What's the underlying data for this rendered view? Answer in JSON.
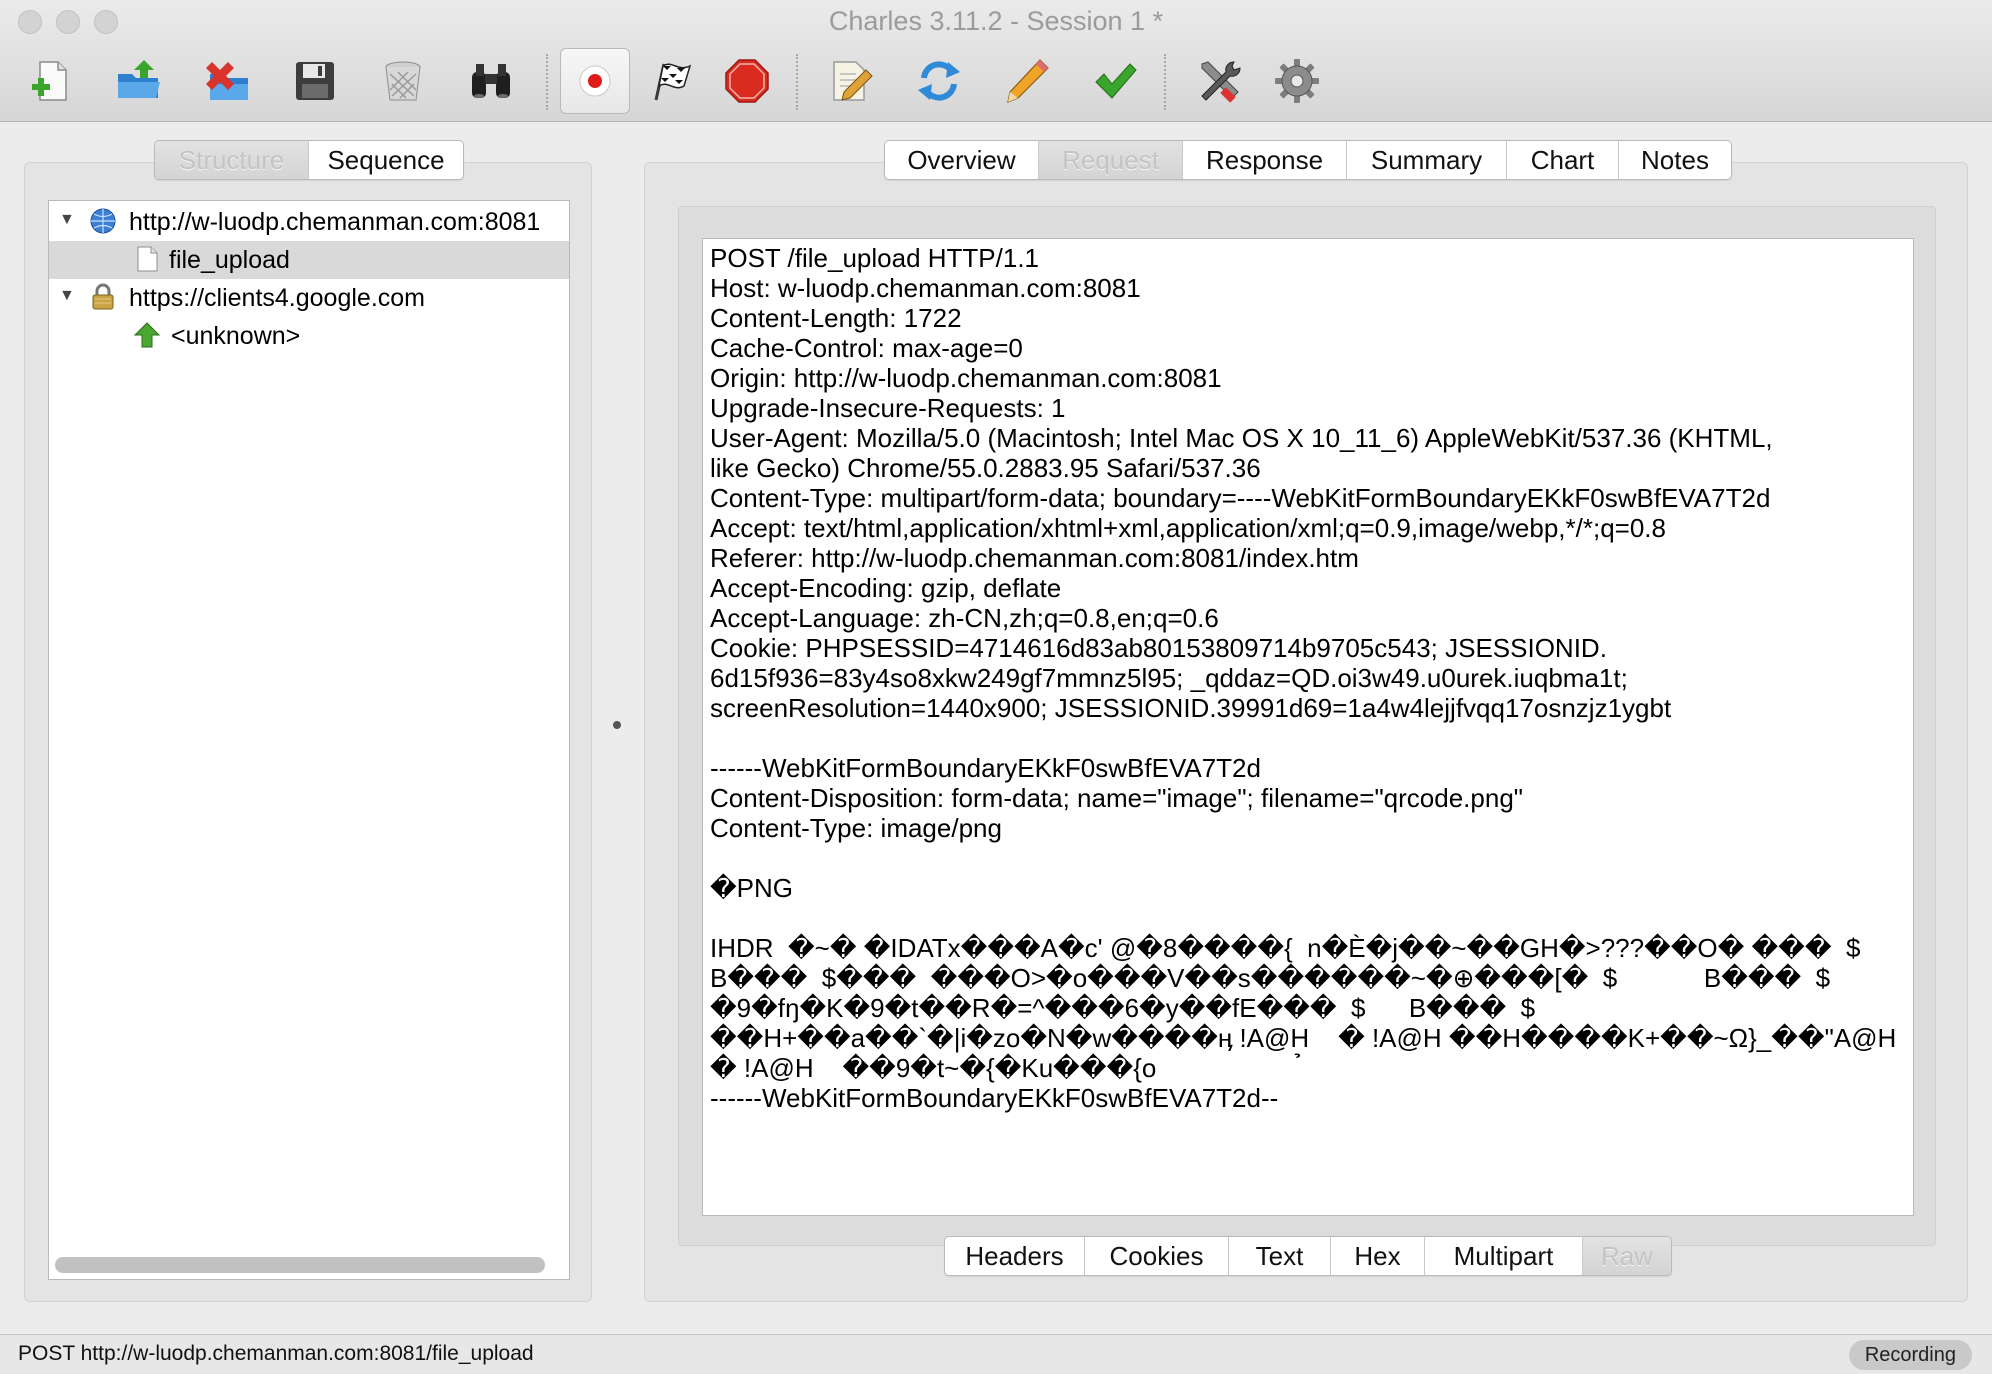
{
  "window": {
    "title": "Charles 3.11.2 - Session 1 *"
  },
  "toolbar": {
    "buttons": [
      {
        "name": "new-session",
        "icon": "new-session-icon"
      },
      {
        "name": "open-session",
        "icon": "open-folder-icon"
      },
      {
        "name": "close-session",
        "icon": "close-session-icon"
      },
      {
        "name": "save-session",
        "icon": "floppy-disk-icon"
      },
      {
        "name": "clear-session",
        "icon": "trash-can-icon"
      },
      {
        "name": "find",
        "icon": "binoculars-icon"
      },
      {
        "name": "record",
        "icon": "record-icon"
      },
      {
        "name": "throttling",
        "icon": "checkered-flag-icon"
      },
      {
        "name": "breakpoints",
        "icon": "stop-sign-icon"
      },
      {
        "name": "compose",
        "icon": "compose-icon"
      },
      {
        "name": "repeat",
        "icon": "repeat-icon"
      },
      {
        "name": "edit",
        "icon": "pencil-icon"
      },
      {
        "name": "validate",
        "icon": "checkmark-icon"
      },
      {
        "name": "tools",
        "icon": "tools-icon"
      },
      {
        "name": "settings",
        "icon": "gear-icon"
      }
    ]
  },
  "left": {
    "tabs": [
      {
        "label": "Structure",
        "selected": true
      },
      {
        "label": "Sequence",
        "selected": false
      }
    ],
    "tree": [
      {
        "label": "http://w-luodp.chemanman.com:8081",
        "level": 0,
        "expanded": true,
        "icon": "globe-icon"
      },
      {
        "label": "file_upload",
        "level": 1,
        "selected": true,
        "icon": "document-icon"
      },
      {
        "label": "https://clients4.google.com",
        "level": 0,
        "expanded": true,
        "icon": "lock-icon"
      },
      {
        "label": "<unknown>",
        "level": 1,
        "icon": "green-arrow-up-icon"
      }
    ]
  },
  "right": {
    "tabs": [
      {
        "label": "Overview",
        "selected": false
      },
      {
        "label": "Request",
        "selected": true
      },
      {
        "label": "Response",
        "selected": false
      },
      {
        "label": "Summary",
        "selected": false
      },
      {
        "label": "Chart",
        "selected": false
      },
      {
        "label": "Notes",
        "selected": false
      }
    ],
    "raw_lines": [
      "POST /file_upload HTTP/1.1",
      "Host: w-luodp.chemanman.com:8081",
      "Content-Length: 1722",
      "Cache-Control: max-age=0",
      "Origin: http://w-luodp.chemanman.com:8081",
      "Upgrade-Insecure-Requests: 1",
      "User-Agent: Mozilla/5.0 (Macintosh; Intel Mac OS X 10_11_6) AppleWebKit/537.36 (KHTML,",
      "like Gecko) Chrome/55.0.2883.95 Safari/537.36",
      "Content-Type: multipart/form-data; boundary=----WebKitFormBoundaryEKkF0swBfEVA7T2d",
      "Accept: text/html,application/xhtml+xml,application/xml;q=0.9,image/webp,*/*;q=0.8",
      "Referer: http://w-luodp.chemanman.com:8081/index.htm",
      "Accept-Encoding: gzip, deflate",
      "Accept-Language: zh-CN,zh;q=0.8,en;q=0.6",
      "Cookie: PHPSESSID=4714616d83ab80153809714b9705c543; JSESSIONID.",
      "6d15f936=83y4so8xkw249gf7mmnz5l95; _qddaz=QD.oi3w49.u0urek.iuqbma1t;",
      "screenResolution=1440x900; JSESSIONID.39991d69=1a4w4lejjfvqq17osnzjz1ygbt",
      "",
      "------WebKitFormBoundaryEKkF0swBfEVA7T2d",
      "Content-Disposition: form-data; name=\"image\"; filename=\"qrcode.png\"",
      "Content-Type: image/png",
      "",
      "�PNG",
      "",
      "IHDR  �~� �IDATx���A�c' @�8����{  n�È�j��~��GH�>???��O� ���  $",
      "B���  $���  ���O>�o���V��s������~�⊕���[�  $            B���  $",
      "�9�fŋ�K�9�t��R�=^���6�y��fE���  $      B���  $",
      "��H+��a��`�|i�zo�N�w����ӊ !A@H    � !A@H ��H����K+��~Ω}_��\"A@H",
      "� !A@H    ��9�t~�{�Ku���{o                    ̉",
      "------WebKitFormBoundaryEKkF0swBfEVA7T2d--"
    ],
    "view_tabs": [
      {
        "label": "Headers",
        "selected": false
      },
      {
        "label": "Cookies",
        "selected": false
      },
      {
        "label": "Text",
        "selected": false
      },
      {
        "label": "Hex",
        "selected": false
      },
      {
        "label": "Multipart",
        "selected": false
      },
      {
        "label": "Raw",
        "selected": true
      }
    ]
  },
  "status": {
    "text": "POST http://w-luodp.chemanman.com:8081/file_upload",
    "badge": "Recording"
  },
  "colors": {
    "selection": "#d9d9d9",
    "record_red": "#e01b1b",
    "stop_red": "#d92b20",
    "check_green": "#2e9a16",
    "folder_blue": "#3a8fd8"
  }
}
